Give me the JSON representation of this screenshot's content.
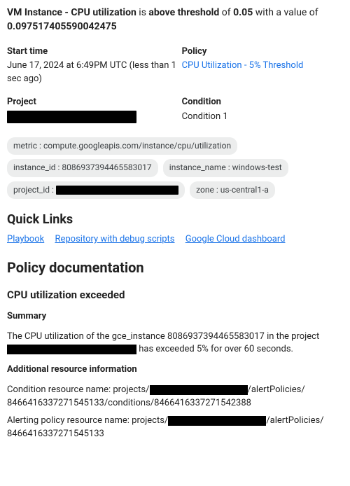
{
  "headline": {
    "p1": "VM Instance - CPU utilization",
    "p2": " is ",
    "p3": "above threshold",
    "p4": " of ",
    "p5": "0.05",
    "p6": " with a value of ",
    "p7": "0.097517405590042475"
  },
  "meta": {
    "start_label": "Start time",
    "start_value": "June 17, 2024 at 6:49PM UTC (less than 1 sec ago)",
    "policy_label": "Policy",
    "policy_link": "CPU Utilization - 5% Threshold",
    "project_label": "Project",
    "condition_label": "Condition",
    "condition_value": "Condition 1"
  },
  "chips": {
    "metric": "metric : compute.googleapis.com/instance/cpu/utilization",
    "instance_id": "instance_id : 8086937394465583017",
    "instance_name": "instance_name : windows-test",
    "project_id_prefix": "project_id : ",
    "zone": "zone : us-central1-a"
  },
  "quick": {
    "heading": "Quick Links",
    "playbook": "Playbook",
    "scripts": "Repository with debug scripts",
    "dashboard": "Google Cloud dashboard"
  },
  "doc": {
    "heading": "Policy documentation",
    "sub": "CPU utilization exceeded",
    "summary_h": "Summary",
    "summary_p1": "The CPU utilization of the gce_instance 8086937394465583017 in the project ",
    "summary_p2": " has exceeded 5% for over 60 seconds.",
    "addl_h": "Additional resource information",
    "cond_p1": "Condition resource name: projects/",
    "cond_p2": "/alertPolicies/",
    "cond_p3": "8466416337271545133/conditions/8466416337271542388",
    "pol_p1": "Alerting policy resource name: projects/",
    "pol_p2": "/alertPolicies/",
    "pol_p3": "8466416337271545133"
  }
}
